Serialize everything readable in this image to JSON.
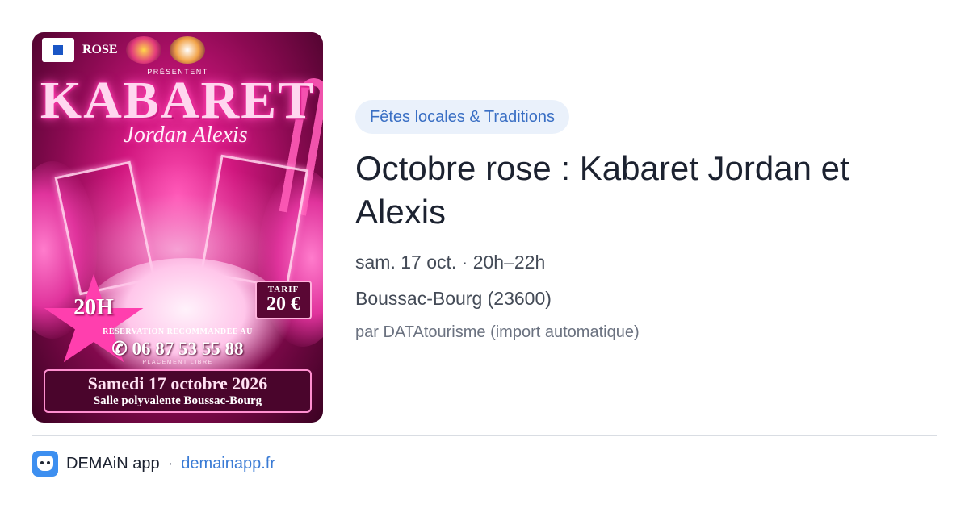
{
  "poster": {
    "org_name": "ROSE",
    "presenting": "PRÉSENTENT",
    "title": "KABARET",
    "subtitle": "Jordan Alexis",
    "time": "20H",
    "price_label": "TARIF",
    "price": "20 €",
    "reservation_note": "RÉSERVATION RECOMMANDÉE AU",
    "phone": "06 87 53 55 88",
    "seating": "PLACEMENT LIBRE",
    "date": "Samedi 17 octobre 2026",
    "venue": "Salle polyvalente Boussac-Bourg",
    "accent_color": "#d1177f"
  },
  "event": {
    "category": "Fêtes locales & Traditions",
    "title": "Octobre rose : Kabaret Jordan et Alexis",
    "date_time": "sam. 17 oct. · 20h–22h",
    "location": "Boussac-Bourg (23600)",
    "source": "par DATAtourisme (import automatique)"
  },
  "footer": {
    "app_icon": "demain-app-icon",
    "app_name": "DEMAiN app",
    "separator": "·",
    "domain": "demainapp.fr"
  },
  "colors": {
    "category_bg": "#eaf1fb",
    "category_text": "#3a6fc4",
    "link": "#3a7bd5",
    "title_text": "#1c2230"
  }
}
